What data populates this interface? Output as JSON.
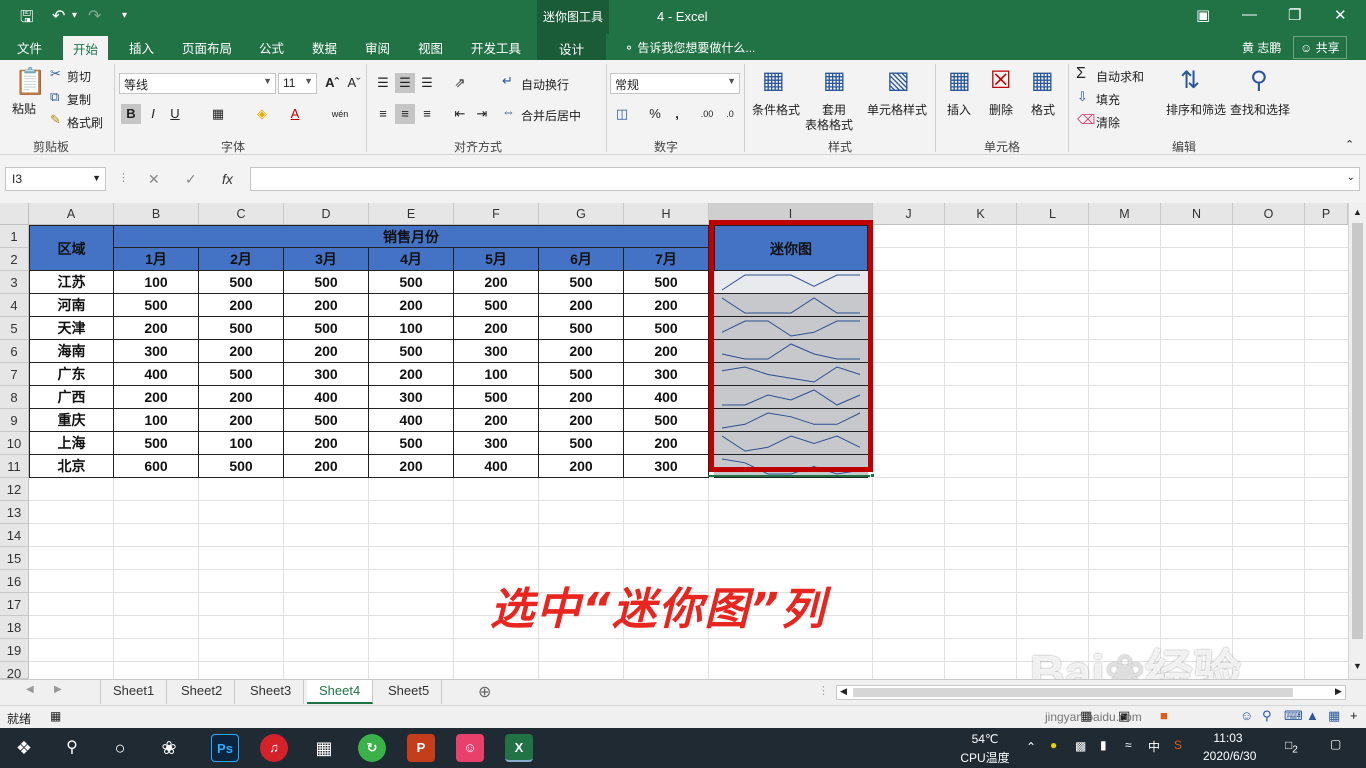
{
  "titlebar": {
    "context_tool": "迷你图工具",
    "app_title": "4 - Excel",
    "save_icon": "save-icon",
    "undo_icon": "undo-icon",
    "redo_icon": "redo-icon"
  },
  "ribbon_tabs": [
    "文件",
    "开始",
    "插入",
    "页面布局",
    "公式",
    "数据",
    "审阅",
    "视图",
    "开发工具",
    "设计"
  ],
  "active_tab": "开始",
  "tell_me": "告诉我您想要做什么...",
  "user_name": "黄 志鹏",
  "share_label": "共享",
  "clipboard": {
    "paste": "粘贴",
    "cut": "剪切",
    "copy": "复制",
    "format_painter": "格式刷",
    "group": "剪贴板"
  },
  "font": {
    "name": "等线",
    "size": "11",
    "group": "字体",
    "bold": "B",
    "italic": "I",
    "underline": "U",
    "wen": "wén"
  },
  "alignment": {
    "wrap": "自动换行",
    "merge": "合并后居中",
    "group": "对齐方式"
  },
  "number": {
    "format": "常规",
    "group": "数字",
    "percent": "%",
    "comma": ","
  },
  "styles": {
    "conditional": "条件格式",
    "table_line1": "套用",
    "table_line2": "表格格式",
    "cell_styles": "单元格样式",
    "group": "样式"
  },
  "cells": {
    "insert": "插入",
    "delete": "删除",
    "format": "格式",
    "group": "单元格"
  },
  "editing": {
    "autosum": "自动求和",
    "fill": "填充",
    "clear": "清除",
    "sort": "排序和筛选",
    "find": "查找和选择",
    "group": "编辑"
  },
  "formula_bar": {
    "name_box": "I3",
    "fx": "fx",
    "value": ""
  },
  "columns": [
    "A",
    "B",
    "C",
    "D",
    "E",
    "F",
    "G",
    "H",
    "I",
    "J",
    "K",
    "L",
    "M",
    "N",
    "O",
    "P"
  ],
  "rows": [
    "1",
    "2",
    "3",
    "4",
    "5",
    "6",
    "7",
    "8",
    "9",
    "10",
    "11",
    "12",
    "13",
    "14",
    "15",
    "16",
    "17",
    "18",
    "19",
    "20"
  ],
  "table": {
    "region_header": "区域",
    "sales_header": "销售月份",
    "sparkline_header": "迷你图",
    "months": [
      "1月",
      "2月",
      "3月",
      "4月",
      "5月",
      "6月",
      "7月"
    ],
    "data": [
      {
        "region": "江苏",
        "values": [
          "100",
          "500",
          "500",
          "500",
          "200",
          "500",
          "500"
        ]
      },
      {
        "region": "河南",
        "values": [
          "500",
          "200",
          "200",
          "200",
          "500",
          "200",
          "200"
        ]
      },
      {
        "region": "天津",
        "values": [
          "200",
          "500",
          "500",
          "100",
          "200",
          "500",
          "500"
        ]
      },
      {
        "region": "海南",
        "values": [
          "300",
          "200",
          "200",
          "500",
          "300",
          "200",
          "200"
        ]
      },
      {
        "region": "广东",
        "values": [
          "400",
          "500",
          "300",
          "200",
          "100",
          "500",
          "300"
        ]
      },
      {
        "region": "广西",
        "values": [
          "200",
          "200",
          "400",
          "300",
          "500",
          "200",
          "400"
        ]
      },
      {
        "region": "重庆",
        "values": [
          "100",
          "200",
          "500",
          "400",
          "200",
          "200",
          "500"
        ]
      },
      {
        "region": "上海",
        "values": [
          "500",
          "100",
          "200",
          "500",
          "300",
          "500",
          "200"
        ]
      },
      {
        "region": "北京",
        "values": [
          "600",
          "500",
          "200",
          "200",
          "400",
          "200",
          "300"
        ]
      }
    ]
  },
  "annotation": "选中“迷你图”列",
  "sheets": [
    "Sheet1",
    "Sheet2",
    "Sheet3",
    "Sheet4",
    "Sheet5"
  ],
  "active_sheet": "Sheet4",
  "status": {
    "ready": "就绪"
  },
  "watermark": {
    "brand": "Bai",
    "brand2": "经验",
    "url": "jingyan.baidu.com"
  },
  "taskbar": {
    "temp": "54℃",
    "temp_label": "CPU温度",
    "time": "11:03",
    "date": "2020/6/30",
    "ime": "中",
    "notify_count": "2"
  },
  "colors": {
    "excel_green": "#217346",
    "header_blue": "#4472c4",
    "highlight_red": "#c00000",
    "annotation_red": "#e8251e"
  }
}
